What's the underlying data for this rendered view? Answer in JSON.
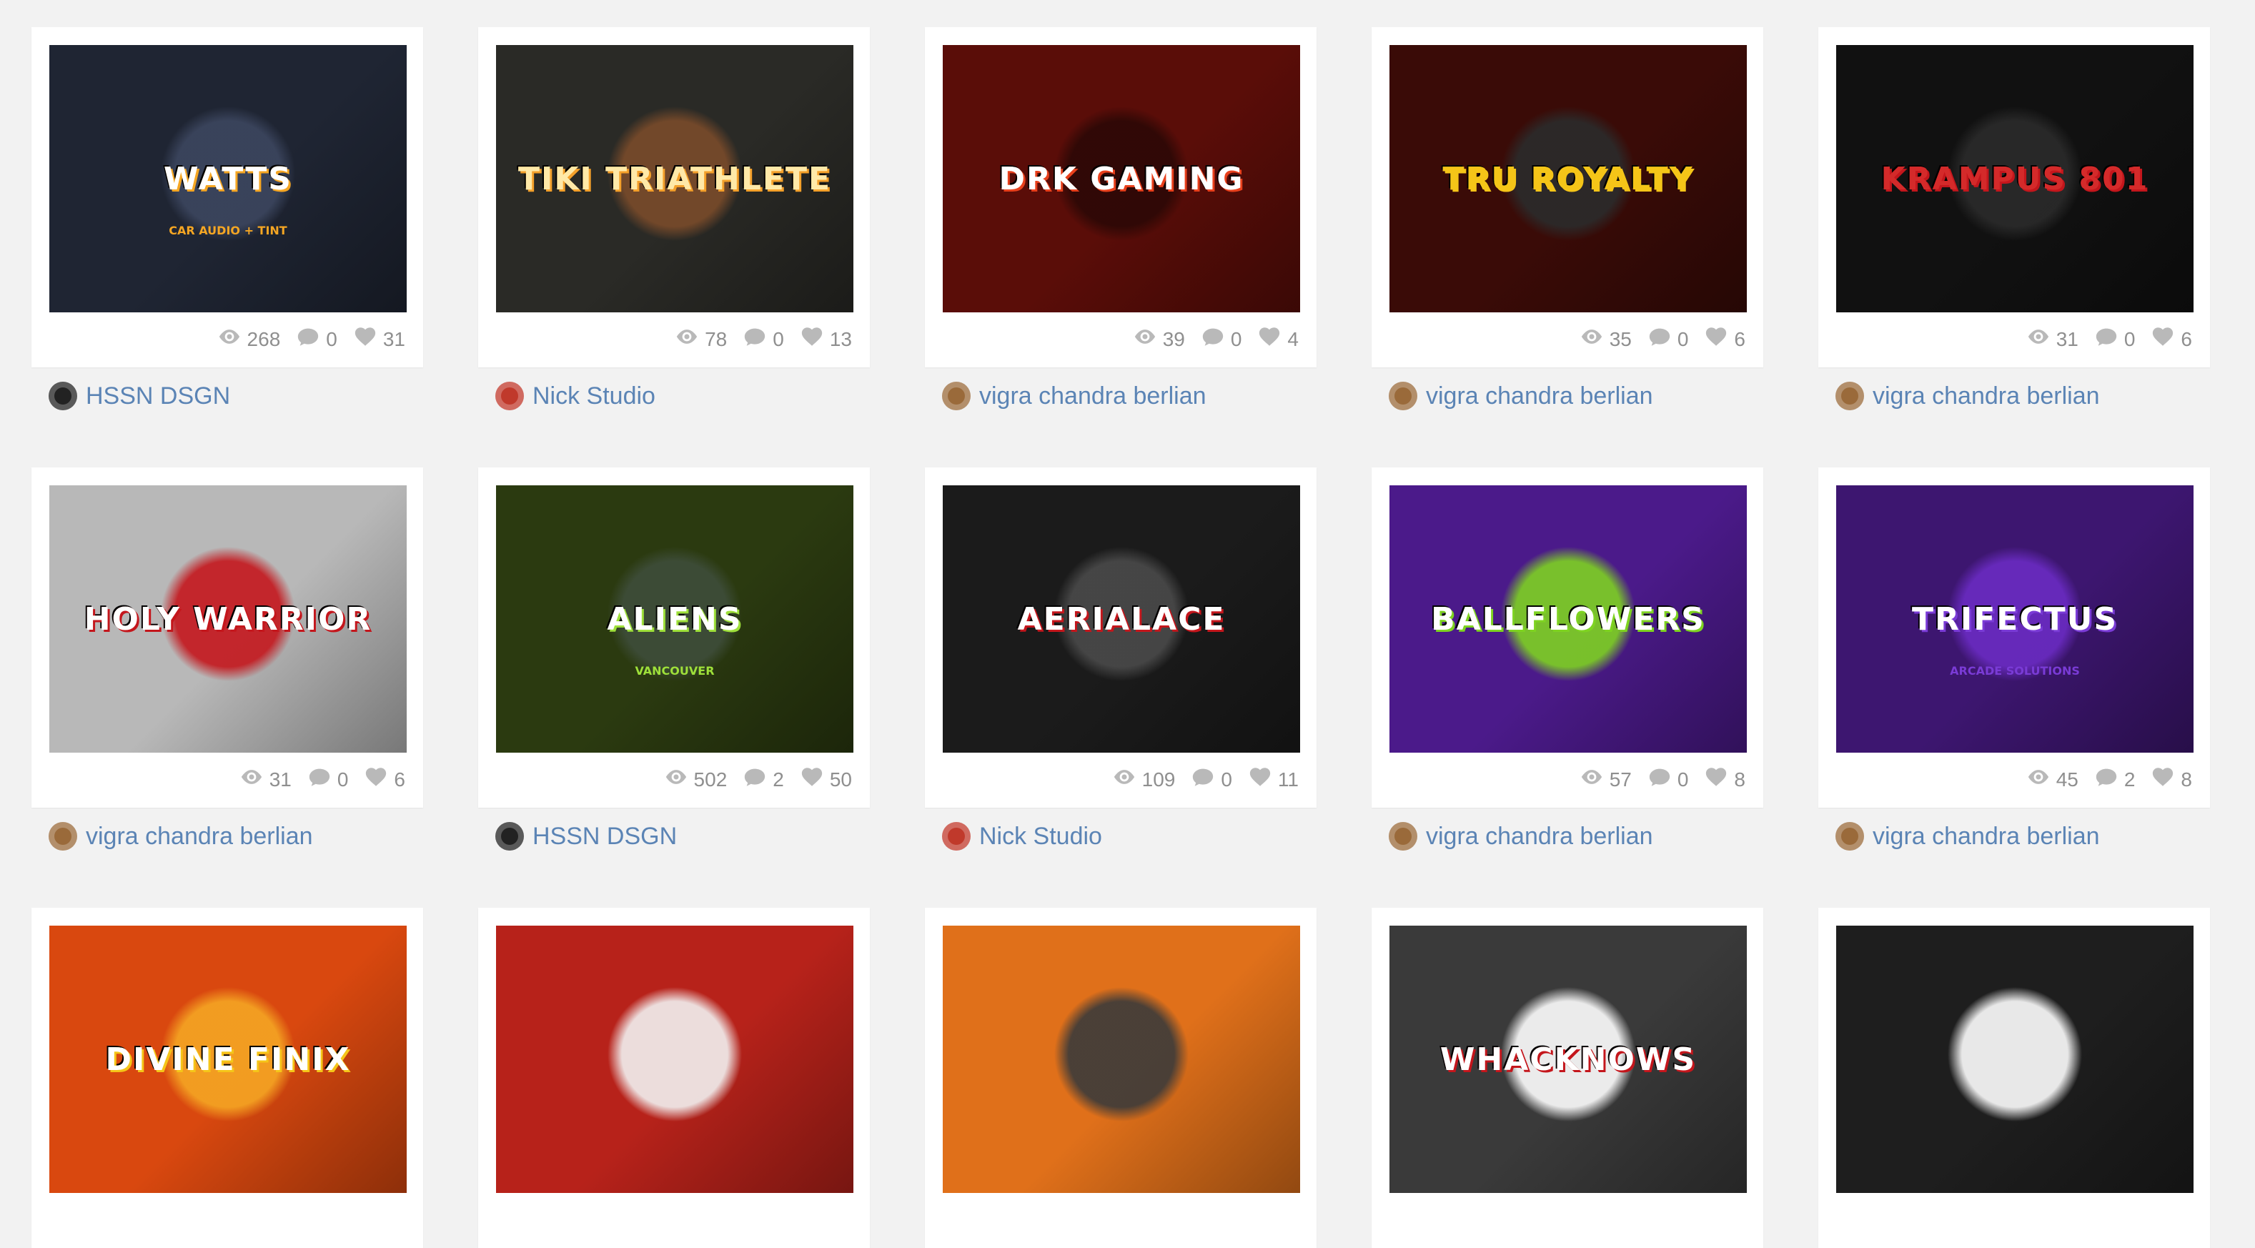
{
  "projects": [
    {
      "logo_text": "WATTS",
      "logo_sub": "CAR AUDIO + TINT",
      "bg": "#1f2533",
      "accent": "#f5a623",
      "text_color": "#ffffff",
      "emblem": "#3c465f",
      "views": "268",
      "comments": "0",
      "likes": "31",
      "author": "HSSN DSGN",
      "avatar_color": "#222222",
      "avatar_icon": "hssn-avatar-icon"
    },
    {
      "logo_text": "TIKI TRIATHLETE",
      "logo_sub": "",
      "bg": "#2a2a26",
      "accent": "#f4a02a",
      "text_color": "#ffe9a8",
      "emblem": "#7a4b2a",
      "views": "78",
      "comments": "0",
      "likes": "13",
      "author": "Nick Studio",
      "avatar_color": "#c0392b",
      "avatar_icon": "skull-avatar-icon"
    },
    {
      "logo_text": "DRK GAMING",
      "logo_sub": "",
      "bg": "#5a0d08",
      "accent": "#e8401c",
      "text_color": "#ffffff",
      "emblem": "#2c0806",
      "views": "39",
      "comments": "0",
      "likes": "4",
      "author": "vigra chandra berlian",
      "avatar_color": "#9a6a3a",
      "avatar_icon": "user-avatar-icon"
    },
    {
      "logo_text": "TRU ROYALTY",
      "logo_sub": "",
      "bg": "#3a0b07",
      "accent": "#f5c518",
      "text_color": "#f5c518",
      "emblem": "#2b2b2b",
      "views": "35",
      "comments": "0",
      "likes": "6",
      "author": "vigra chandra berlian",
      "avatar_color": "#9a6a3a",
      "avatar_icon": "user-avatar-icon"
    },
    {
      "logo_text": "KRAMPUS 801",
      "logo_sub": "",
      "bg": "#111111",
      "accent": "#c4161c",
      "text_color": "#d42a2a",
      "emblem": "#2a2a2a",
      "views": "31",
      "comments": "0",
      "likes": "6",
      "author": "vigra chandra berlian",
      "avatar_color": "#9a6a3a",
      "avatar_icon": "user-avatar-icon"
    },
    {
      "logo_text": "HOLY WARRIOR",
      "logo_sub": "",
      "bg": "#b8b8b8",
      "accent": "#c4161c",
      "text_color": "#ffffff",
      "emblem": "#c4161c",
      "views": "31",
      "comments": "0",
      "likes": "6",
      "author": "vigra chandra berlian",
      "avatar_color": "#9a6a3a",
      "avatar_icon": "user-avatar-icon"
    },
    {
      "logo_text": "ALIENS",
      "logo_sub": "VANCOUVER",
      "bg": "#2b3a10",
      "accent": "#9ee03a",
      "text_color": "#ffffff",
      "emblem": "#3e4d3a",
      "views": "502",
      "comments": "2",
      "likes": "50",
      "author": "HSSN DSGN",
      "avatar_color": "#222222",
      "avatar_icon": "hssn-avatar-icon"
    },
    {
      "logo_text": "AERIALACE",
      "logo_sub": "",
      "bg": "#1b1b1b",
      "accent": "#c4161c",
      "text_color": "#ffffff",
      "emblem": "#4a4a4a",
      "views": "109",
      "comments": "0",
      "likes": "11",
      "author": "Nick Studio",
      "avatar_color": "#c0392b",
      "avatar_icon": "skull-avatar-icon"
    },
    {
      "logo_text": "BALLFLOWERS",
      "logo_sub": "",
      "bg": "#4b1a8a",
      "accent": "#7ed321",
      "text_color": "#ffffff",
      "emblem": "#7ed321",
      "views": "57",
      "comments": "0",
      "likes": "8",
      "author": "vigra chandra berlian",
      "avatar_color": "#9a6a3a",
      "avatar_icon": "user-avatar-icon"
    },
    {
      "logo_text": "TRIFECTUS",
      "logo_sub": "ARCADE SOLUTIONS",
      "bg": "#3d1670",
      "accent": "#7a3bd6",
      "text_color": "#ffffff",
      "emblem": "#6a2bc2",
      "views": "45",
      "comments": "2",
      "likes": "8",
      "author": "vigra chandra berlian",
      "avatar_color": "#9a6a3a",
      "avatar_icon": "user-avatar-icon"
    },
    {
      "logo_text": "DIVINE FINIX",
      "logo_sub": "",
      "bg": "#d9480f",
      "accent": "#f5c518",
      "text_color": "#ffffff",
      "emblem": "#f5a623",
      "views": "",
      "comments": "",
      "likes": "",
      "author": "",
      "avatar_color": "",
      "avatar_icon": ""
    },
    {
      "logo_text": "",
      "logo_sub": "",
      "bg": "#b7221a",
      "accent": "#ffffff",
      "text_color": "#ffffff",
      "emblem": "#f2f2f2",
      "views": "",
      "comments": "",
      "likes": "",
      "author": "",
      "avatar_color": "",
      "avatar_icon": ""
    },
    {
      "logo_text": "",
      "logo_sub": "",
      "bg": "#e0701a",
      "accent": "#333333",
      "text_color": "#ffffff",
      "emblem": "#3a3a3a",
      "views": "",
      "comments": "",
      "likes": "",
      "author": "",
      "avatar_color": "",
      "avatar_icon": ""
    },
    {
      "logo_text": "WHACKNOWS",
      "logo_sub": "",
      "bg": "#3a3a3a",
      "accent": "#c4161c",
      "text_color": "#ffffff",
      "emblem": "#ffffff",
      "views": "",
      "comments": "",
      "likes": "",
      "author": "",
      "avatar_color": "",
      "avatar_icon": ""
    },
    {
      "logo_text": "",
      "logo_sub": "",
      "bg": "#1e1e1e",
      "accent": "#c4161c",
      "text_color": "#ffffff",
      "emblem": "#ffffff",
      "views": "",
      "comments": "",
      "likes": "",
      "author": "",
      "avatar_color": "",
      "avatar_icon": ""
    }
  ],
  "icons": {
    "views": "eye-icon",
    "comments": "comment-icon",
    "likes": "heart-icon"
  }
}
